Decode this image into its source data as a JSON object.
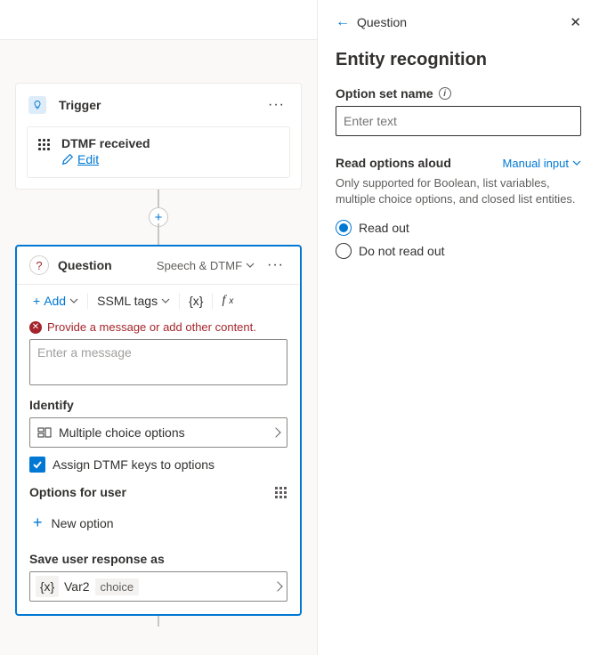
{
  "trigger": {
    "title": "Trigger",
    "event_title": "DTMF received",
    "edit_label": "Edit"
  },
  "question": {
    "title": "Question",
    "mode": "Speech & DTMF",
    "add_label": "Add",
    "ssml_label": "SSML tags",
    "var_icon": "{x}",
    "fx_icon": "fx",
    "error_text": "Provide a message or add other content.",
    "message_placeholder": "Enter a message",
    "identify_label": "Identify",
    "identify_value": "Multiple choice options",
    "assign_label": "Assign DTMF keys to options",
    "options_heading": "Options for user",
    "new_option_label": "New option",
    "save_label": "Save user response as",
    "var_name": "Var2",
    "var_type": "choice"
  },
  "panel": {
    "crumb": "Question",
    "title": "Entity recognition",
    "option_set_label": "Option set name",
    "option_set_placeholder": "Enter text",
    "read_heading": "Read options aloud",
    "read_mode": "Manual input",
    "read_hint": "Only supported for Boolean, list variables, multiple choice options, and closed list entities.",
    "radio_read": "Read out",
    "radio_noread": "Do not read out"
  }
}
